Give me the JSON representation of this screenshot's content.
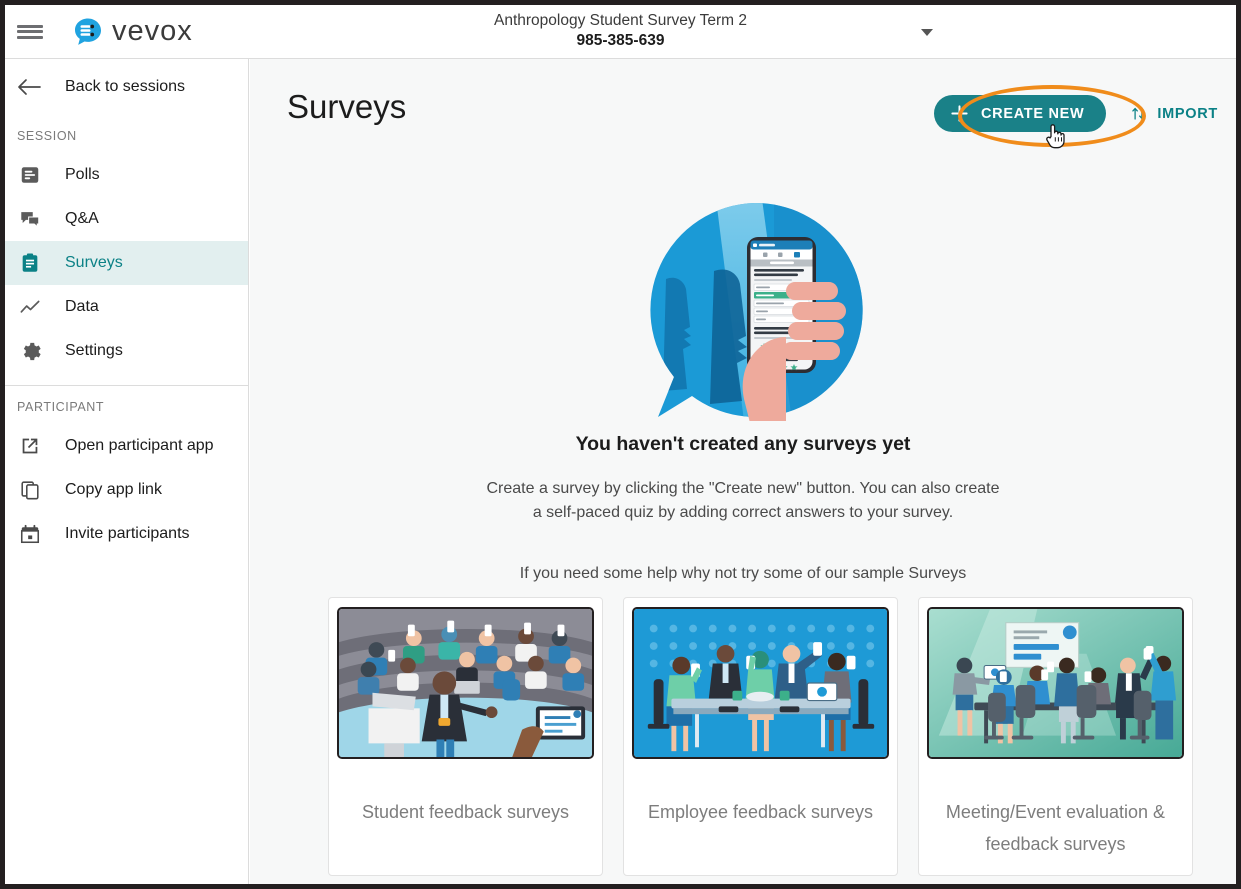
{
  "window": {
    "border_color": "#231f20"
  },
  "topbar": {
    "menu_icon": "hamburger-icon",
    "logo_icon": "vevox-logo-icon",
    "logo_text": "vevox",
    "session_name": "Anthropology Student Survey Term 2",
    "session_code": "985-385-639",
    "caret_icon": "chevron-down-icon"
  },
  "sidebar": {
    "back": {
      "icon": "arrow-left-icon",
      "label": "Back to sessions"
    },
    "section_session_label": "SESSION",
    "section_participant_label": "PARTICIPANT",
    "session_items": [
      {
        "icon": "polls-icon",
        "label": "Polls",
        "active": false
      },
      {
        "icon": "qa-icon",
        "label": "Q&A",
        "active": false
      },
      {
        "icon": "surveys-icon",
        "label": "Surveys",
        "active": true
      },
      {
        "icon": "data-icon",
        "label": "Data",
        "active": false
      },
      {
        "icon": "settings-gear-icon",
        "label": "Settings",
        "active": false
      }
    ],
    "participant_items": [
      {
        "icon": "external-link-icon",
        "label": "Open participant app"
      },
      {
        "icon": "copy-icon",
        "label": "Copy app link"
      },
      {
        "icon": "calendar-icon",
        "label": "Invite participants"
      }
    ],
    "active_bg": "#e2efef",
    "active_fg": "#0b8186"
  },
  "main": {
    "page_title": "Surveys",
    "create_button_label": "CREATE NEW",
    "create_button_icon": "plus-icon",
    "create_button_color": "#1a8188",
    "import_label": "IMPORT",
    "import_icon": "sort-arrows-icon",
    "import_color": "#0b8186",
    "highlight_color": "#f08c1b",
    "cursor_icon": "pointer-hand-cursor",
    "illustration_icon": "survey-phone-illustration",
    "empty_title": "You haven't created any surveys yet",
    "empty_body_line1": "Create a survey by clicking the \"Create new\" button. You can also create",
    "empty_body_line2": "a self-paced quiz by adding correct answers to your survey.",
    "sample_hint": "If you need some help why not try some of our sample Surveys",
    "sample_cards": [
      {
        "label": "Student feedback surveys",
        "thumb_icon": "lecture-hall-illustration"
      },
      {
        "label": "Employee feedback surveys",
        "thumb_icon": "office-meeting-illustration"
      },
      {
        "label": "Meeting/Event evaluation & feedback surveys",
        "thumb_icon": "conference-room-illustration"
      }
    ]
  }
}
